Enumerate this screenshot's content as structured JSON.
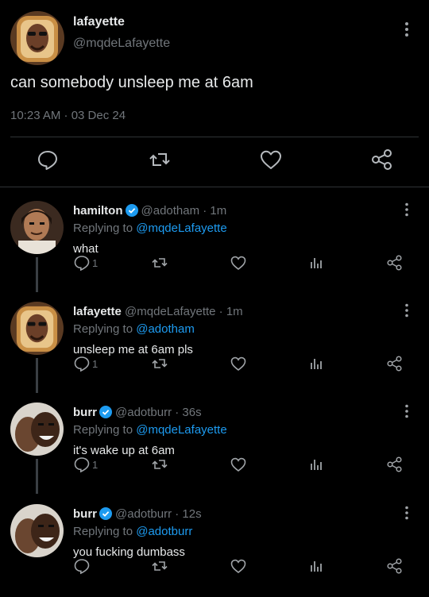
{
  "main_tweet": {
    "name": "lafayette",
    "handle": "@mqdeLafayette",
    "text": "can somebody unsleep me at 6am",
    "meta": "10:23 AM · 03 Dec 24"
  },
  "replies": [
    {
      "name": "hamilton",
      "verified": true,
      "handle_time": "@adotham · 1m",
      "replying_prefix": "Replying to ",
      "replying_to": "@mqdeLafayette",
      "text": "what",
      "reply_count": "1",
      "avatar": "hamilton"
    },
    {
      "name": "lafayette",
      "verified": false,
      "handle_time": "@mqdeLafayette · 1m",
      "replying_prefix": "Replying to ",
      "replying_to": "@adotham",
      "text": "unsleep me at 6am pls",
      "reply_count": "1",
      "avatar": "lafayette"
    },
    {
      "name": "burr",
      "verified": true,
      "handle_time": "@adotburr · 36s",
      "replying_prefix": "Replying to ",
      "replying_to": "@mqdeLafayette",
      "text": "it's wake up at 6am",
      "reply_count": "1",
      "avatar": "burr"
    },
    {
      "name": "burr",
      "verified": true,
      "handle_time": "@adotburr · 12s",
      "replying_prefix": "Replying to ",
      "replying_to": "@adotburr",
      "text": "you fucking dumbass",
      "reply_count": "",
      "avatar": "burr"
    }
  ],
  "colors": {
    "background": "#000000",
    "text": "#e7e9ea",
    "muted": "#71767b",
    "link": "#1d9bf0",
    "divider": "#2f3336"
  }
}
